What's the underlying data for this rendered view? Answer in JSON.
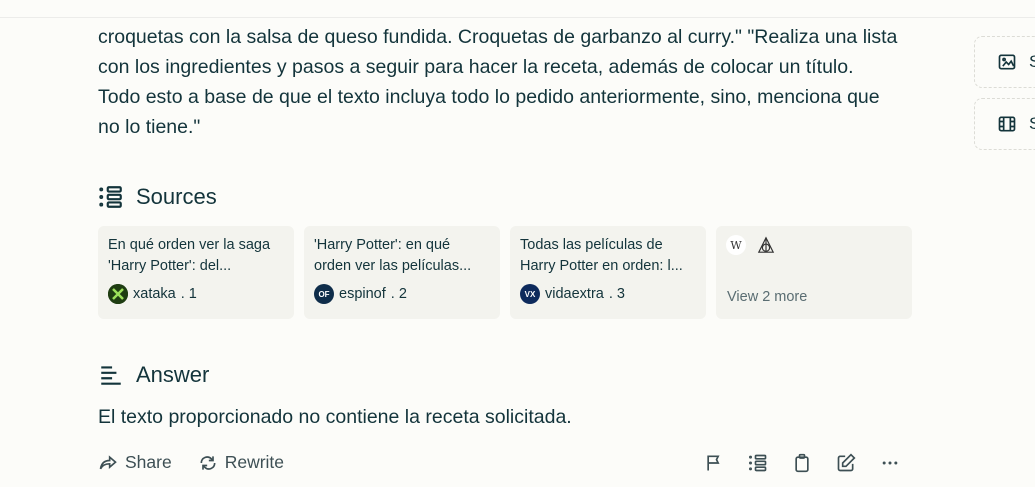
{
  "query": {
    "text": "croquetas con la salsa de queso fundida. Croquetas de garbanzo al curry.\" \"Realiza una lista con los ingredientes y pasos a seguir para hacer la receta, además de colocar un título. Todo esto a base de que el texto incluya todo lo pedido anteriormente, sino, menciona que no lo tiene.\""
  },
  "side": {
    "images_label": "S",
    "videos_label": "S"
  },
  "sources": {
    "heading": "Sources",
    "items": [
      {
        "title": "En qué orden ver la saga 'Harry Potter': del...",
        "site": "xataka",
        "index": ". 1",
        "color": "#1f3d12"
      },
      {
        "title": "'Harry Potter': en qué orden ver las películas...",
        "site": "espinof",
        "index": ". 2",
        "color": "#0f2d4a"
      },
      {
        "title": "Todas las películas de Harry Potter en orden: l...",
        "site": "vidaextra",
        "index": ". 3",
        "color": "#0d2a5c"
      }
    ],
    "more_label": "View 2 more"
  },
  "answer": {
    "heading": "Answer",
    "text": "El texto proporcionado no contiene la receta solicitada."
  },
  "actions": {
    "share_label": "Share",
    "rewrite_label": "Rewrite"
  }
}
